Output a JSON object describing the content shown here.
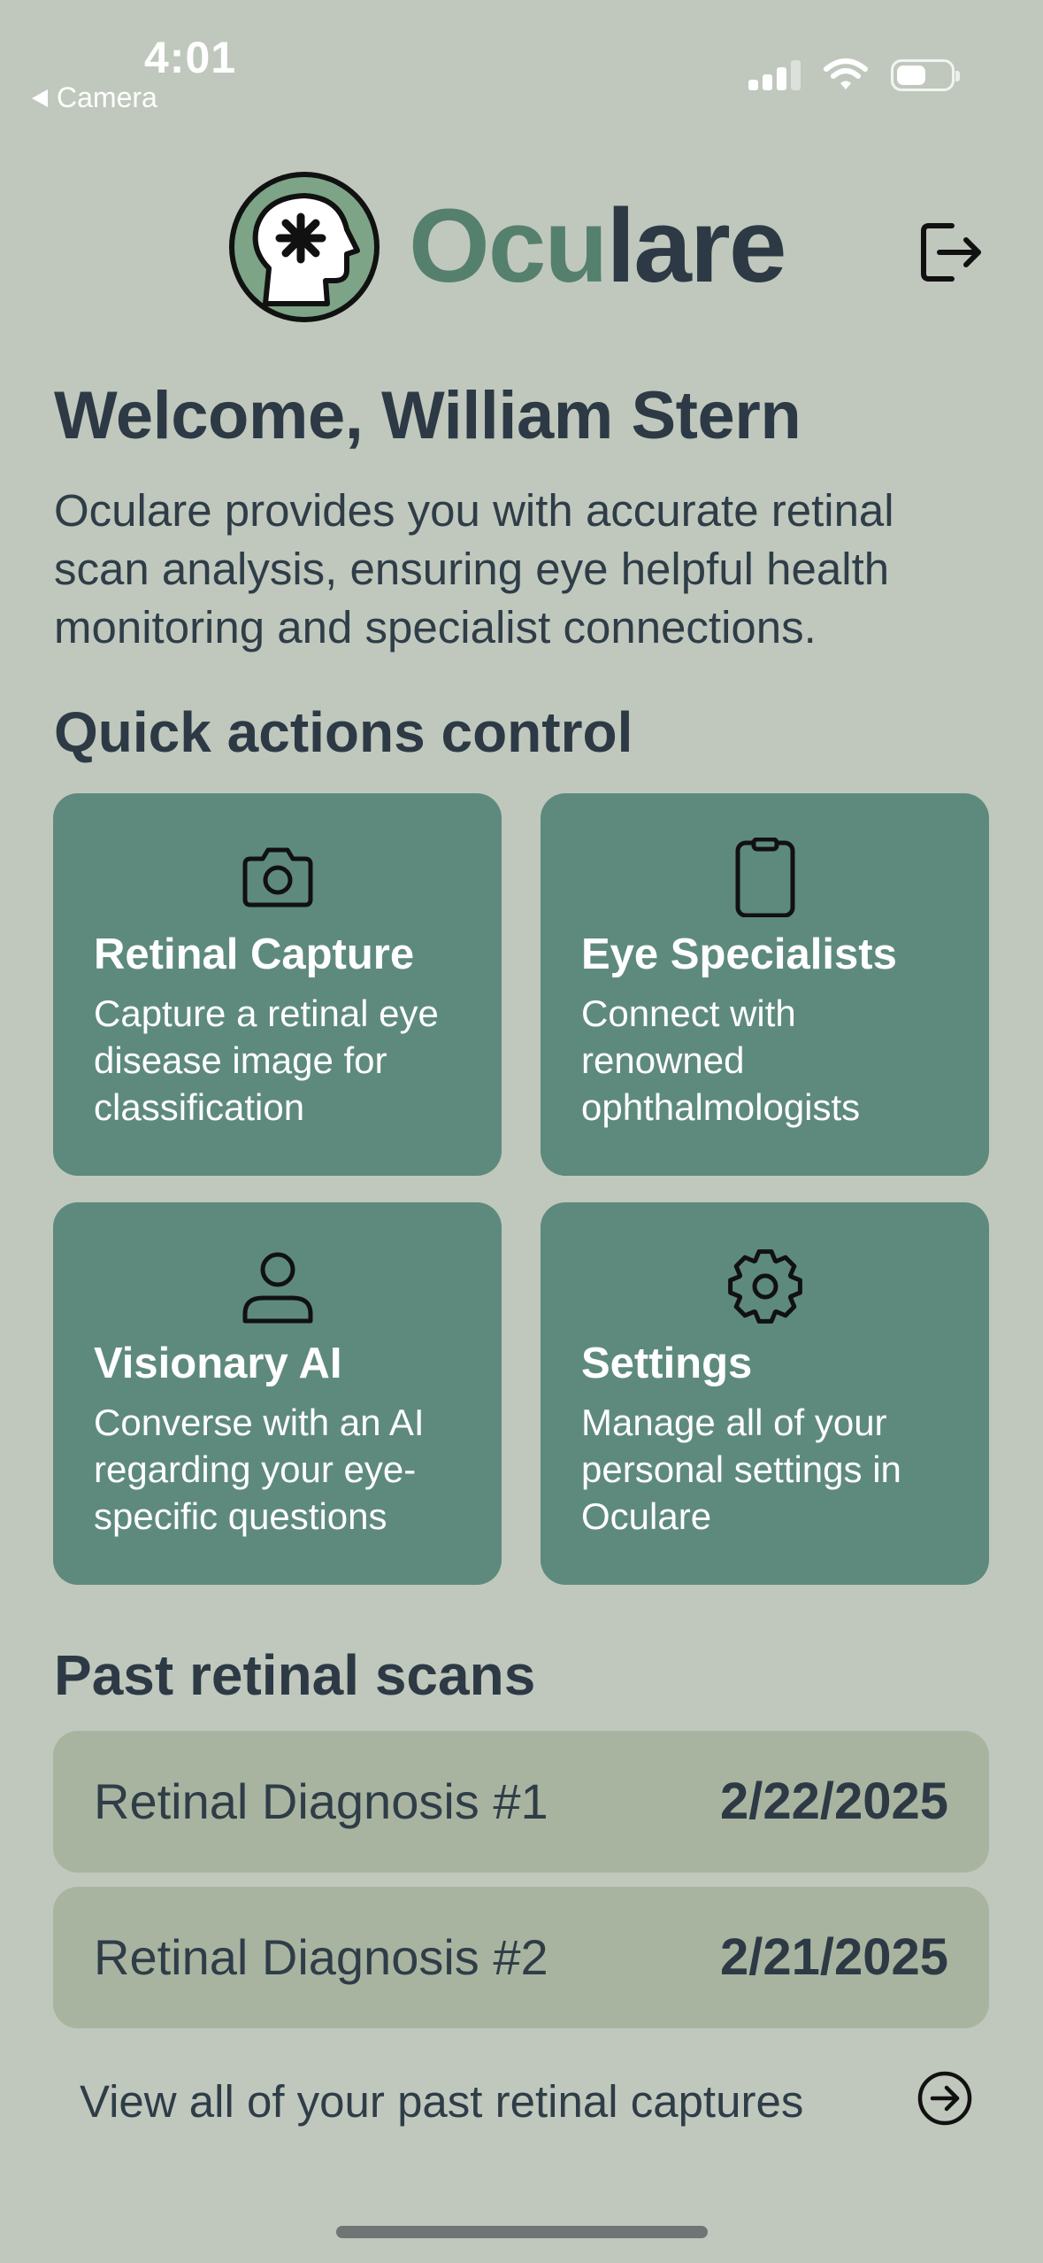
{
  "status_bar": {
    "time": "4:01",
    "back_label": "Camera",
    "battery_level": 0.55
  },
  "header": {
    "brand_part1": "Ocu",
    "brand_part2": "lare",
    "logo_icon": "head-asterisk-icon",
    "logout_icon": "logout-icon"
  },
  "welcome": {
    "title": "Welcome, William Stern",
    "intro": "Oculare provides you with accurate retinal scan analysis, ensuring eye helpful health monitoring and specialist connections."
  },
  "quick_actions": {
    "title": "Quick actions control",
    "cards": [
      {
        "title": "Retinal Capture",
        "description": "Capture a retinal eye disease image for classification",
        "icon": "camera-icon"
      },
      {
        "title": "Eye Specialists",
        "description": "Connect with renowned ophthalmologists",
        "icon": "clipboard-icon"
      },
      {
        "title": "Visionary AI",
        "description": "Converse with an AI regarding your eye-specific questions",
        "icon": "person-icon"
      },
      {
        "title": "Settings",
        "description": "Manage all of your personal settings in Oculare",
        "icon": "gear-icon"
      }
    ]
  },
  "past_scans": {
    "title": "Past retinal scans",
    "items": [
      {
        "name": "Retinal Diagnosis #1",
        "date": "2/22/2025"
      },
      {
        "name": "Retinal Diagnosis #2",
        "date": "2/21/2025"
      }
    ],
    "view_all": "View all of your past retinal captures"
  },
  "colors": {
    "background": "#c0c8bd",
    "card": "#5e8a7d",
    "scan_row": "#a9b4a0",
    "brand_green": "#56806e",
    "text_dark": "#2d3a45"
  }
}
